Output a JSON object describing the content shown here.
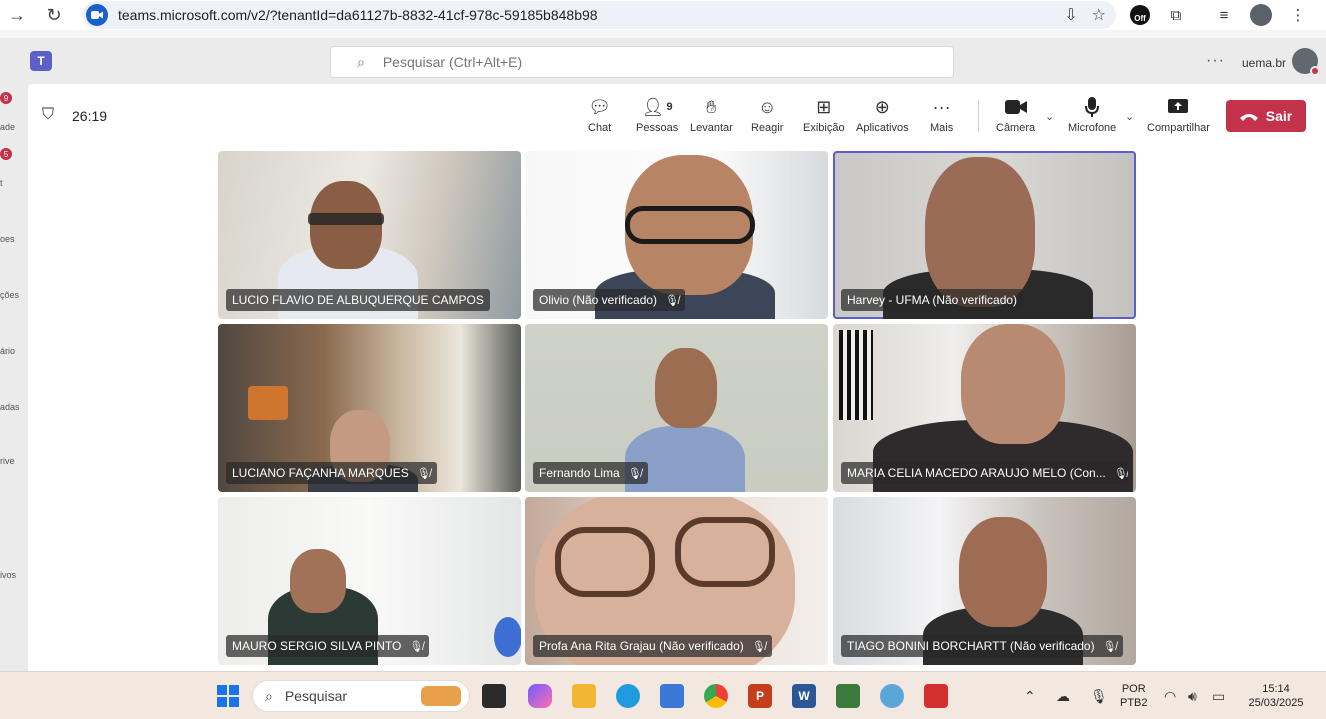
{
  "browser": {
    "url": "teams.microsoft.com/v2/?tenantId=da61127b-8832-41cf-978c-59185b848b98",
    "off_badge": "Off"
  },
  "header": {
    "search_placeholder": "Pesquisar (Ctrl+Alt+E)",
    "org_name": "uema.br"
  },
  "rail": {
    "items": [
      {
        "label": "ade",
        "badge": "9"
      },
      {
        "label": "t",
        "badge": "5"
      },
      {
        "label": "oes",
        "badge": ""
      },
      {
        "label": "ções",
        "badge": ""
      },
      {
        "label": "ário",
        "badge": ""
      },
      {
        "label": "adas",
        "badge": ""
      },
      {
        "label": "rive",
        "badge": ""
      },
      {
        "label": "ivos",
        "badge": ""
      }
    ]
  },
  "meeting": {
    "timer": "26:19",
    "toolbar": {
      "chat": "Chat",
      "people": "Pessoas",
      "people_count": "9",
      "raise": "Levantar",
      "react": "Reagir",
      "view": "Exibição",
      "apps": "Aplicativos",
      "more": "Mais",
      "camera": "Câmera",
      "mic": "Microfone",
      "share": "Compartilhar",
      "leave": "Sair"
    },
    "participants": [
      {
        "name": "LUCIO FLAVIO DE ALBUQUERQUE CAMPOS",
        "muted": false
      },
      {
        "name": "Olivio (Não verificado)",
        "muted": true
      },
      {
        "name": "Harvey - UFMA (Não verificado)",
        "muted": false
      },
      {
        "name": "LUCIANO FAÇANHA MARQUES",
        "muted": true
      },
      {
        "name": "Fernando Lima",
        "muted": true
      },
      {
        "name": "MARIA CELIA MACEDO ARAUJO MELO (Con...",
        "muted": true
      },
      {
        "name": "MAURO SERGIO SILVA PINTO",
        "muted": true
      },
      {
        "name": "Profa Ana Rita Grajau (Não verificado)",
        "muted": true
      },
      {
        "name": "TIAGO BONINI BORCHARTT (Não verificado)",
        "muted": true
      }
    ]
  },
  "taskbar": {
    "search_label": "Pesquisar",
    "lang_top": "POR",
    "lang_bottom": "PTB2",
    "time": "15:14",
    "date": "25/03/2025"
  },
  "colors": {
    "accent": "#5b5fc7",
    "leave": "#c4314b"
  }
}
